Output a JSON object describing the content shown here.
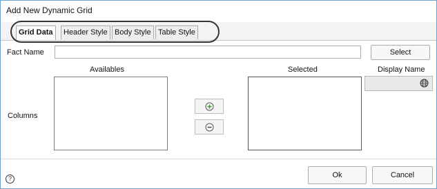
{
  "dialog": {
    "title": "Add New Dynamic Grid"
  },
  "tabs": [
    {
      "label": "Grid Data",
      "active": true
    },
    {
      "label": "Header Style",
      "active": false
    },
    {
      "label": "Body Style",
      "active": false
    },
    {
      "label": "Table Style",
      "active": false
    }
  ],
  "fact": {
    "label": "Fact Name",
    "value": "",
    "select_label": "Select"
  },
  "columns": {
    "label": "Columns",
    "availables_header": "Availables",
    "selected_header": "Selected",
    "display_name_header": "Display Name",
    "add_icon": "plus-circle-icon",
    "remove_icon": "minus-circle-icon",
    "display_name_icon": "globe-icon"
  },
  "footer": {
    "ok_label": "Ok",
    "cancel_label": "Cancel",
    "help_icon": "help-icon"
  },
  "colors": {
    "add_green": "#3c9a2e",
    "frame_blue": "#6e9fcf"
  }
}
